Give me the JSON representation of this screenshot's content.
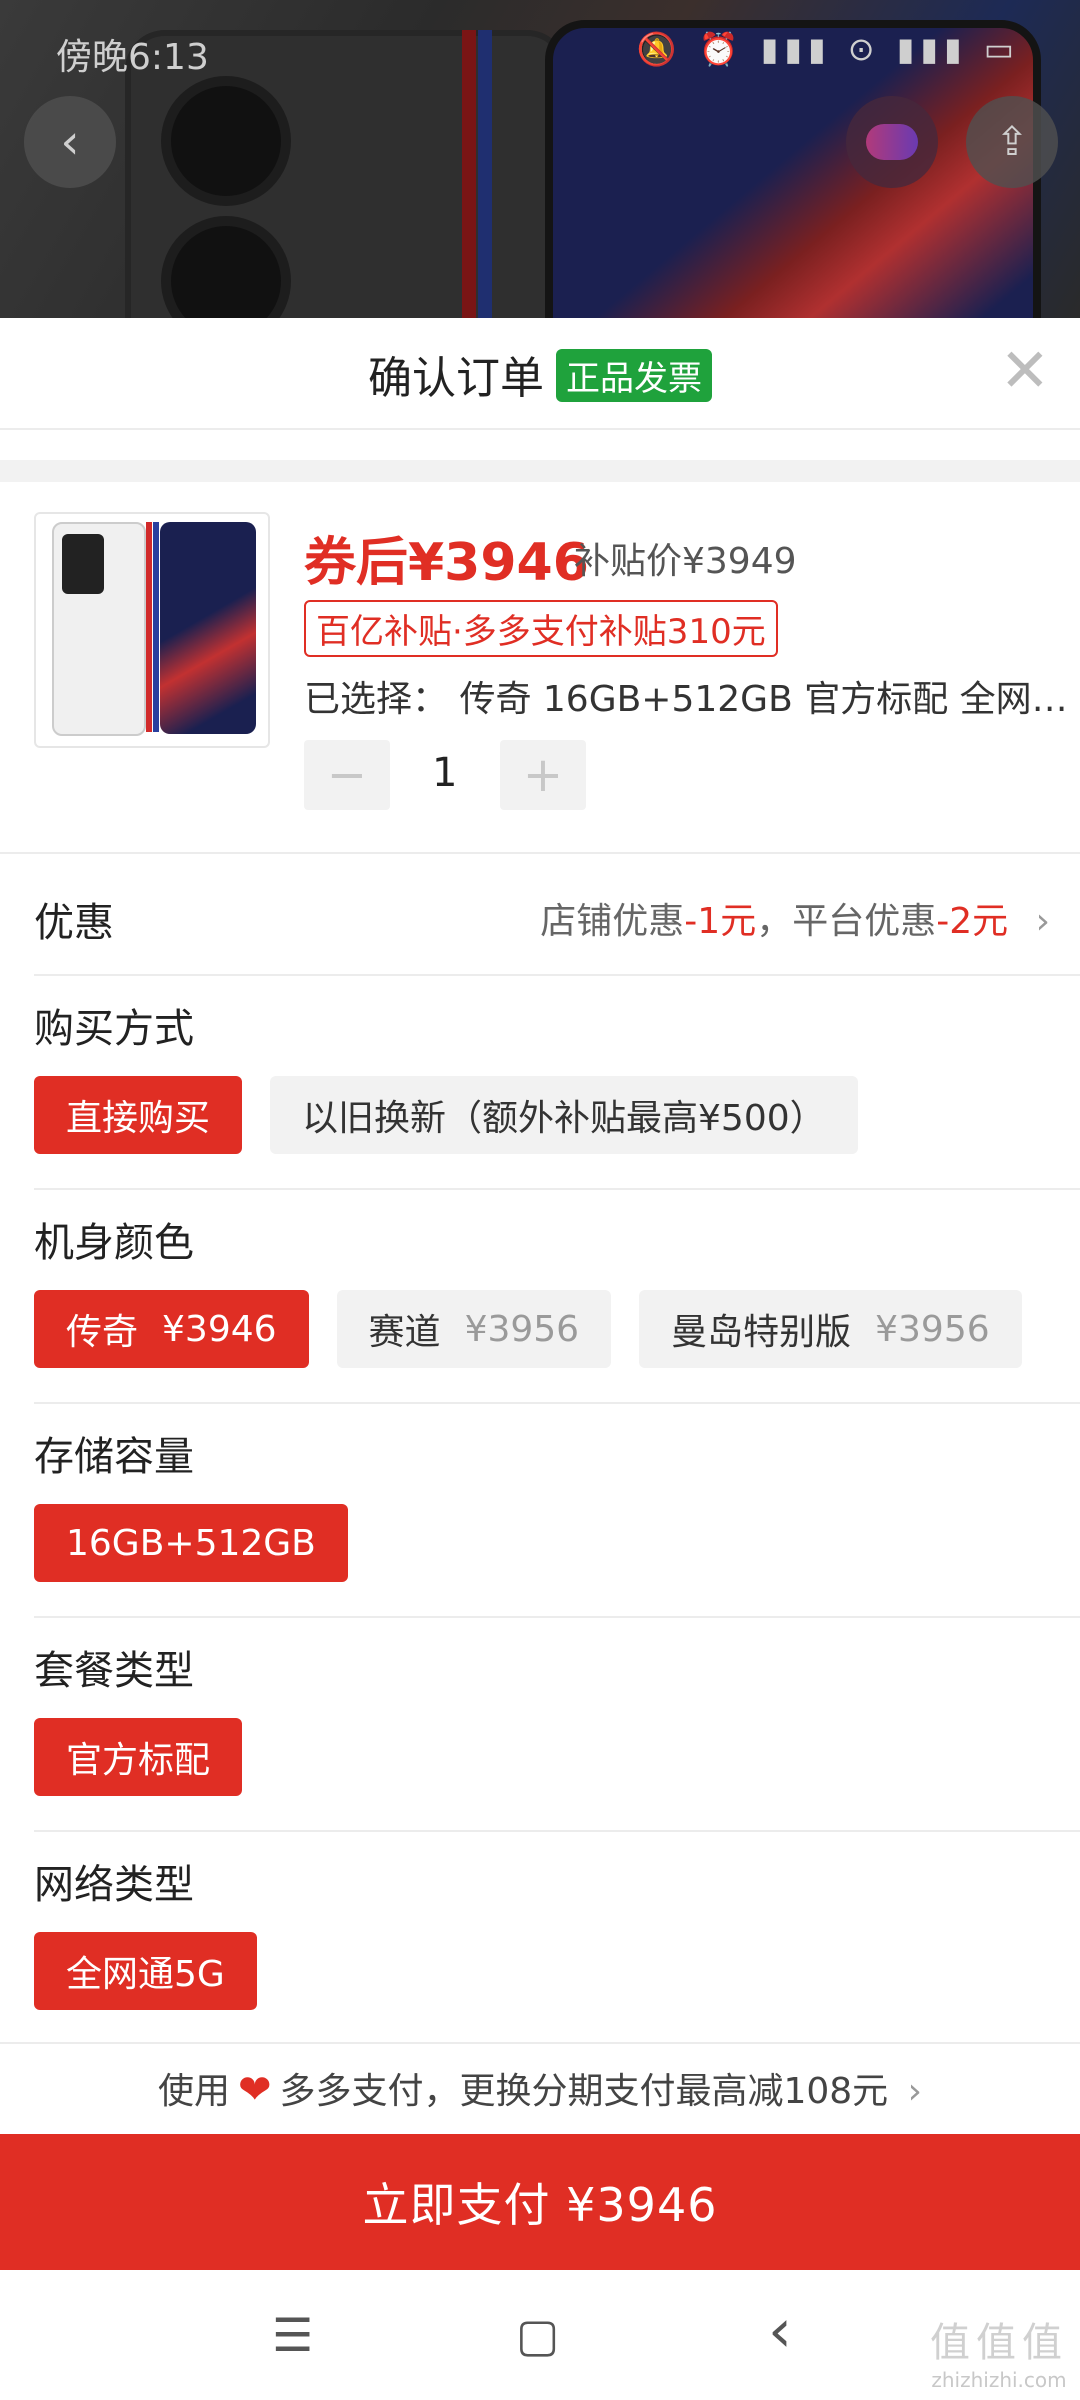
{
  "status_bar": {
    "time": "傍晚6:13",
    "icons": "🔕 ⏰   ▮▮▮ ⊙ ▮▮▮ ▭"
  },
  "header": {
    "title": "确认订单",
    "badge": "正品发票"
  },
  "product": {
    "price_after_coupon": "券后¥3946",
    "subsidy_price": "补贴价¥3949",
    "subsidy_tag": "百亿补贴·多多支付补贴310元",
    "selected": "已选择：  传奇 16GB+512GB 官方标配 全网…",
    "quantity": "1",
    "minus": "−",
    "plus": "+"
  },
  "promo": {
    "label": "优惠",
    "shop_text": "店铺优惠",
    "shop_value": "-1元",
    "sep": "，",
    "platform_text": "平台优惠",
    "platform_value": "-2元",
    "chevron": "›"
  },
  "options": [
    {
      "title": "购买方式",
      "chips": [
        {
          "label": "直接购买",
          "active": true
        },
        {
          "label": "以旧换新（额外补贴最高¥500）",
          "active": false
        }
      ]
    },
    {
      "title": "机身颜色",
      "chips": [
        {
          "label": "传奇",
          "price": "¥3946",
          "active": true
        },
        {
          "label": "赛道",
          "price": "¥3956",
          "active": false
        },
        {
          "label": "曼岛特别版",
          "price": "¥3956",
          "active": false
        }
      ]
    },
    {
      "title": "存储容量",
      "chips": [
        {
          "label": "16GB+512GB",
          "active": true
        }
      ]
    },
    {
      "title": "套餐类型",
      "chips": [
        {
          "label": "官方标配",
          "active": true
        }
      ]
    },
    {
      "title": "网络类型",
      "chips": [
        {
          "label": "全网通5G",
          "active": true
        }
      ]
    }
  ],
  "pay_tip": {
    "prefix": "使用",
    "brand": "多多支付，更换分期支付最高减108元",
    "chevron": "›"
  },
  "pay_button": {
    "label": "立即支付 ¥3946"
  },
  "nav": {
    "menu": "☰",
    "home": "▢",
    "back": "‹"
  },
  "watermark": {
    "big": "值值值",
    "small": "zhizhizhi.com"
  },
  "colors": {
    "accent": "#e02e24",
    "badge_green": "#1fa23c"
  }
}
